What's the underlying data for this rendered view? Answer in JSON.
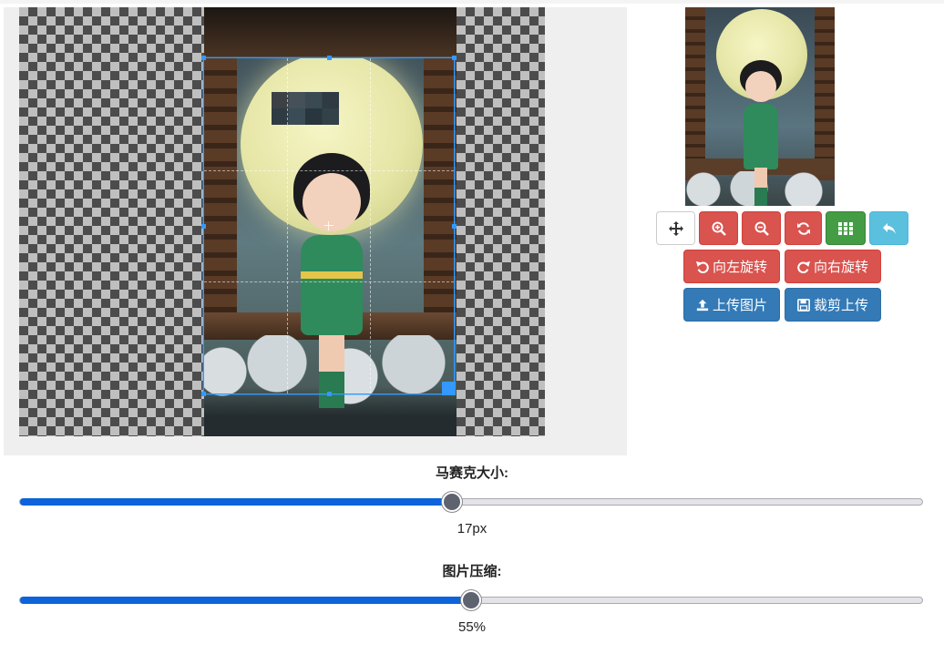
{
  "toolbar": {
    "move": {
      "icon": "move-icon"
    },
    "zoom_in": {
      "icon": "zoom-in-icon"
    },
    "zoom_out": {
      "icon": "zoom-out-icon"
    },
    "refresh": {
      "icon": "refresh-icon"
    },
    "mosaic": {
      "icon": "grid-icon"
    },
    "undo": {
      "icon": "undo-icon"
    },
    "rotate_left_label": "向左旋转",
    "rotate_right_label": "向右旋转",
    "upload_label": "上传图片",
    "crop_upload_label": "裁剪上传"
  },
  "sliders": [
    {
      "label": "马赛克大小:",
      "value_text": "17px",
      "fraction": 0.479
    },
    {
      "label": "图片压缩:",
      "value_text": "55%",
      "fraction": 0.5
    }
  ],
  "colors": {
    "danger": "#d9534f",
    "success": "#449d44",
    "info": "#5bc0de",
    "primary": "#337ab7",
    "crop_accent": "#3399ff",
    "slider_fill": "#0d63d9"
  }
}
